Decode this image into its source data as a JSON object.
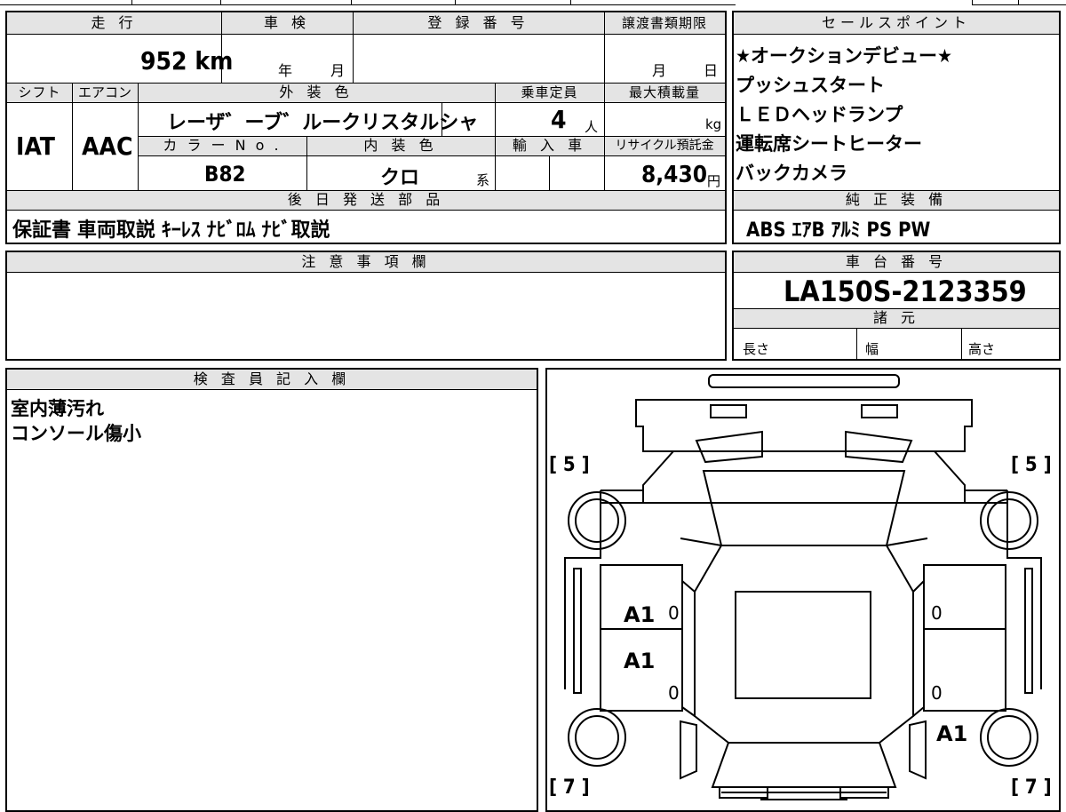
{
  "spec": {
    "mileage": {
      "label": "走 行",
      "value": "952 km"
    },
    "inspection": {
      "label": "車 検",
      "year_unit": "年",
      "month_unit": "月"
    },
    "registration": {
      "label": "登 録 番 号",
      "value": ""
    },
    "transfer_deadline": {
      "label": "譲渡書類期限",
      "month_unit": "月",
      "day_unit": "日"
    },
    "shift": {
      "label": "シフト",
      "value": "IAT"
    },
    "aircon": {
      "label": "エアコン",
      "value": "AAC"
    },
    "exterior_color": {
      "label": "外 装 色",
      "value": "レーザ゛ーブ゛ルークリスタルシャ"
    },
    "capacity": {
      "label": "乗車定員",
      "value": "4",
      "unit": "人"
    },
    "max_load": {
      "label": "最大積載量",
      "unit": "kg"
    },
    "color_no": {
      "label": "カ ラ ー N o .",
      "value": "B82"
    },
    "interior_color": {
      "label": "内 装 色",
      "value": "クロ",
      "unit": "系"
    },
    "import": {
      "label": "輸 入 車"
    },
    "recycle": {
      "label": "リサイクル預託金",
      "value": "8,430",
      "unit": "円"
    }
  },
  "later_parts": {
    "label": "後 日 発 送 部 品",
    "items": "保証書 車両取説 ｷｰﾚｽ ﾅﾋﾞﾛﾑ ﾅﾋﾞ取説"
  },
  "sales_points": {
    "label": "セールスポイント",
    "items": [
      "★オークションデビュー★",
      "プッシュスタート",
      "ＬＥＤヘッドランプ",
      "運転席シートヒーター",
      "バックカメラ"
    ]
  },
  "genuine_equipment": {
    "label": "純 正 装 備",
    "value": "ABS ｴｱB ｱﾙﾐ PS PW"
  },
  "notes": {
    "label": "注 意 事 項 欄",
    "value": ""
  },
  "chassis": {
    "label": "車 台 番 号",
    "value": "LA150S-2123359"
  },
  "dimensions": {
    "label": "諸 元",
    "length": "長さ",
    "width": "幅",
    "height": "高さ"
  },
  "inspector": {
    "label": "検 査 員 記 入 欄",
    "lines": [
      "室内薄汚れ",
      "コンソール傷小"
    ]
  },
  "diagram": {
    "tire_front_left": "[ 5 ]",
    "tire_front_right": "[ 5 ]",
    "tire_rear_left": "[ 7 ]",
    "tire_rear_right": "[ 7 ]",
    "marks": {
      "front_left_door": "A1",
      "rear_left_door": "A1",
      "rear_right_quarter": "A1",
      "zero_fl": "0",
      "zero_rl": "0",
      "zero_fr": "0",
      "zero_rr": "0"
    }
  }
}
